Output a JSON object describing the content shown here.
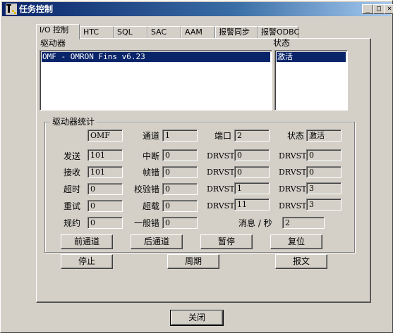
{
  "window": {
    "title": "任务控制",
    "btn_min": "_",
    "btn_max": "□",
    "btn_close": "×"
  },
  "tabs": [
    {
      "label": "I/O 控制"
    },
    {
      "label": "HTC"
    },
    {
      "label": "SQL"
    },
    {
      "label": "SAC"
    },
    {
      "label": "AAM"
    },
    {
      "label": "报警同步"
    },
    {
      "label": "报警ODBC"
    }
  ],
  "drivers": {
    "label": "驱动器",
    "selected": "OMF - OMRON Fins v6.23"
  },
  "status": {
    "label": "状态",
    "selected": "激活"
  },
  "stats": {
    "title": "驱动器统计",
    "driver": "OMF",
    "channel_label": "通道",
    "channel": "1",
    "port_label": "端口",
    "port": "2",
    "status_label": "状态",
    "status": "激活",
    "send_label": "发送",
    "send": "101",
    "interrupt_label": "中断",
    "interrupt": "0",
    "recv_label": "接收",
    "recv": "101",
    "frame_err_label": "帧错",
    "frame_err": "0",
    "timeout_label": "超时",
    "timeout": "0",
    "checksum_label": "校验错",
    "checksum": "0",
    "retry_label": "重试",
    "retry": "0",
    "overload_label": "超载",
    "overload": "0",
    "protocol_label": "规约",
    "protocol": "0",
    "general_err_label": "一般错",
    "general_err": "0",
    "drvsta_label": "DRVSTA",
    "drvsta": "0",
    "drvstb_label": "DRVSTB",
    "drvstb": "0",
    "drvstc_label": "DRVSTC",
    "drvstc": "1",
    "drvstd_label": "DRVSTD",
    "drvstd": "11",
    "drvste_label": "DRVSTE",
    "drvste": "0",
    "drvstf_label": "DRVSTF",
    "drvstf": "0",
    "drvstg_label": "DRVSTG",
    "drvstg": "3",
    "drvsth_label": "DRVSTH",
    "drvsth": "3",
    "msgrate_label": "消息 / 秒",
    "msgrate": "2"
  },
  "buttons": {
    "prev_channel": "前通道",
    "next_channel": "后通道",
    "pause": "暂停",
    "reset": "复位",
    "stop": "停止",
    "period": "周期",
    "report": "报文",
    "close": "关闭"
  }
}
